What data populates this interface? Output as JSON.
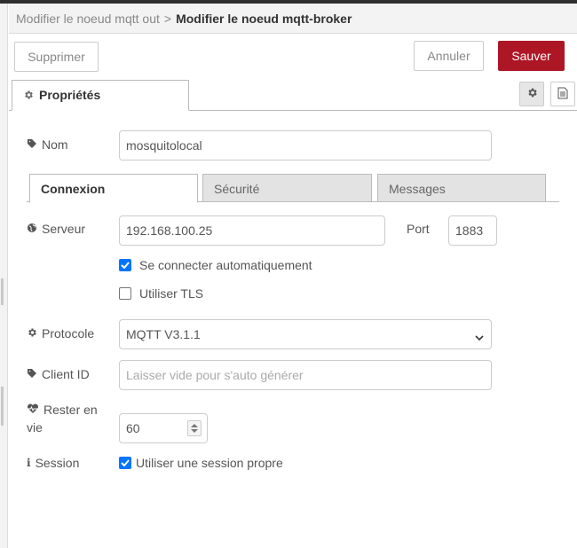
{
  "breadcrumb": {
    "parent": "Modifier le noeud mqtt out",
    "separator": ">",
    "current": "Modifier le noeud mqtt-broker"
  },
  "toolbar": {
    "delete_label": "Supprimer",
    "cancel_label": "Annuler",
    "save_label": "Sauver",
    "save_color": "#ad1625"
  },
  "tabs": {
    "properties_label": "Propriétés"
  },
  "form": {
    "name": {
      "label": "Nom",
      "value": "mosquitolocal"
    },
    "subtabs": [
      "Connexion",
      "Sécurité",
      "Messages"
    ],
    "server": {
      "label": "Serveur",
      "value": "192.168.100.25"
    },
    "port": {
      "label": "Port",
      "value": "1883"
    },
    "auto_connect": {
      "label": "Se connecter automatiquement",
      "checked": true
    },
    "use_tls": {
      "label": "Utiliser TLS",
      "checked": false
    },
    "protocol": {
      "label": "Protocole",
      "value": "MQTT V3.1.1"
    },
    "client_id": {
      "label": "Client ID",
      "value": "",
      "placeholder": "Laisser vide pour s'auto générer"
    },
    "keepalive": {
      "label_line1": "Rester en",
      "label_line2": "vie",
      "value": "60"
    },
    "session": {
      "label": "Session",
      "checkbox_label": "Utiliser une session propre",
      "checked": true
    }
  },
  "icons": {
    "properties": "gear-icon",
    "name": "tag-icon",
    "server": "globe-icon",
    "protocol": "gear-icon",
    "client_id": "tag-icon",
    "keepalive": "heartbeat-icon",
    "session": "info-icon",
    "settings_button": "gear-icon",
    "description_button": "file-text-icon"
  },
  "accent_color": "#0075ff"
}
